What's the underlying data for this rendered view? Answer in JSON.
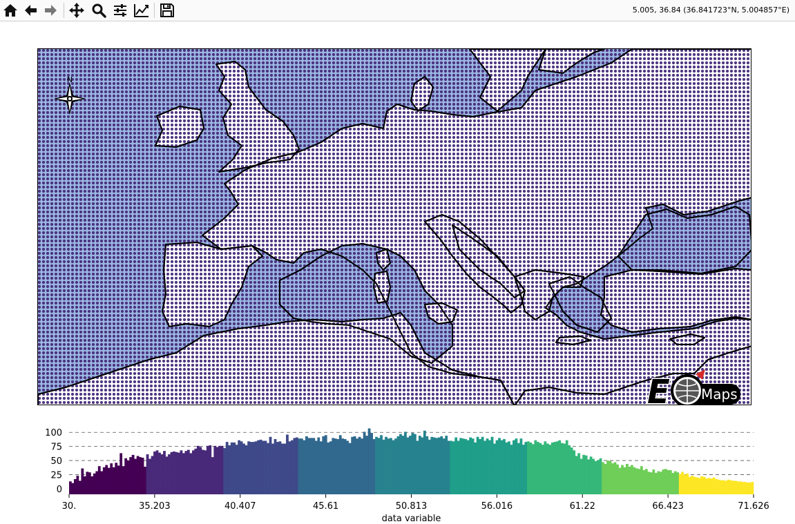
{
  "toolbar": {
    "buttons": [
      {
        "id": "home",
        "icon": "home-icon"
      },
      {
        "id": "back",
        "icon": "arrow-left-icon"
      },
      {
        "id": "forward",
        "icon": "arrow-right-icon"
      },
      {
        "id": "pan",
        "icon": "move-icon"
      },
      {
        "id": "zoom",
        "icon": "magnifier-icon"
      },
      {
        "id": "configure",
        "icon": "sliders-icon"
      },
      {
        "id": "edit-axes",
        "icon": "line-chart-icon"
      },
      {
        "id": "save",
        "icon": "floppy-disk-icon"
      }
    ],
    "coords": "5.005, 36.84 (36.841723°N, 5.004857°E)"
  },
  "map": {
    "compass_letter": "N",
    "logo_text": "Maps",
    "logo_letter": "E",
    "colors": {
      "ocean": "#9bb7e3",
      "land": "#ffffff",
      "coast": "#000000",
      "logo_red": "#d42b2b"
    }
  },
  "chart_data": {
    "type": "bar",
    "xlabel": "data variable",
    "x_ticks": [
      "30.",
      "35.203",
      "40.407",
      "45.61",
      "50.813",
      "56.016",
      "61.22",
      "66.423",
      "71.626"
    ],
    "xlim": [
      30.0,
      71.626
    ],
    "y_ticks": [
      "0",
      "25",
      "50",
      "75",
      "100"
    ],
    "ylim": [
      -10,
      115
    ],
    "grid": "y-dashed",
    "bin_colors": [
      "#440154",
      "#482878",
      "#3e4989",
      "#31688e",
      "#26828e",
      "#1f9e89",
      "#35b779",
      "#6ece58",
      "#fde725"
    ],
    "values": [
      13,
      10,
      17,
      23,
      14,
      36,
      22,
      30,
      29,
      22,
      27,
      31,
      40,
      31,
      38,
      42,
      37,
      45,
      38,
      46,
      41,
      63,
      40,
      54,
      50,
      56,
      60,
      53,
      58,
      56,
      55,
      39,
      61,
      53,
      58,
      66,
      68,
      64,
      61,
      67,
      57,
      61,
      65,
      66,
      65,
      64,
      68,
      63,
      67,
      69,
      63,
      68,
      71,
      76,
      74,
      69,
      68,
      76,
      77,
      56,
      76,
      74,
      76,
      76,
      72,
      83,
      77,
      82,
      82,
      78,
      86,
      84,
      80,
      77,
      84,
      83,
      83,
      84,
      86,
      87,
      85,
      85,
      81,
      92,
      80,
      88,
      83,
      84,
      80,
      80,
      96,
      84,
      86,
      90,
      91,
      89,
      89,
      86,
      93,
      90,
      90,
      90,
      85,
      91,
      84,
      93,
      95,
      82,
      84,
      90,
      89,
      88,
      95,
      89,
      88,
      85,
      81,
      92,
      93,
      89,
      92,
      89,
      101,
      94,
      107,
      99,
      88,
      92,
      90,
      95,
      87,
      92,
      89,
      90,
      86,
      89,
      93,
      97,
      94,
      101,
      91,
      94,
      99,
      97,
      85,
      94,
      91,
      103,
      93,
      87,
      92,
      91,
      90,
      91,
      93,
      89,
      94,
      85,
      85,
      84,
      91,
      85,
      90,
      89,
      88,
      86,
      91,
      89,
      82,
      92,
      88,
      92,
      85,
      89,
      86,
      92,
      80,
      86,
      90,
      86,
      88,
      82,
      84,
      78,
      86,
      89,
      81,
      89,
      78,
      83,
      84,
      82,
      79,
      86,
      83,
      81,
      78,
      84,
      80,
      78,
      82,
      83,
      84,
      86,
      81,
      80,
      86,
      77,
      73,
      68,
      58,
      63,
      53,
      60,
      59,
      52,
      57,
      53,
      49,
      51,
      54,
      47,
      44,
      50,
      49,
      45,
      47,
      43,
      37,
      42,
      38,
      44,
      39,
      42,
      38,
      36,
      35,
      40,
      33,
      35,
      30,
      29,
      34,
      28,
      31,
      30,
      34,
      35,
      33,
      33,
      28,
      31,
      29,
      26,
      30,
      25,
      27,
      21,
      23,
      21,
      20,
      19,
      22,
      21,
      18,
      19,
      18,
      20,
      17,
      16,
      15,
      15,
      14,
      16,
      15,
      14,
      14,
      13,
      13,
      12,
      12,
      11,
      11,
      12
    ]
  }
}
